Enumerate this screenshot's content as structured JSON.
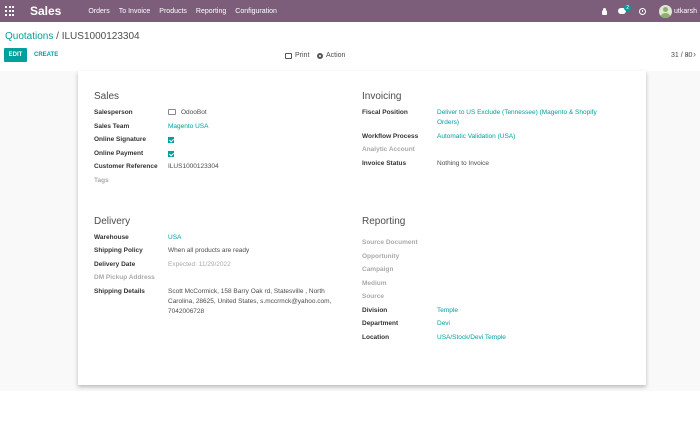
{
  "app": {
    "brand": "Sales",
    "menu": [
      "Orders",
      "To Invoice",
      "Products",
      "Reporting",
      "Configuration"
    ],
    "chat_count": "2",
    "user": "utkarsh"
  },
  "breadcrumb": {
    "parent": "Quotations",
    "separator": "/",
    "current": "ILUS1000123304"
  },
  "toolbar": {
    "edit_label": "EDIT",
    "create_label": "CREATE",
    "print_label": "Print",
    "action_label": "Action",
    "pager": "31 / 80",
    "prev": "‹",
    "next": "›"
  },
  "sales": {
    "title": "Sales",
    "salesperson_label": "Salesperson",
    "salesperson": "OdooBot",
    "sales_team_label": "Sales Team",
    "sales_team": "Magento USA",
    "online_signature_label": "Online Signature",
    "online_signature": true,
    "online_payment_label": "Online Payment",
    "online_payment": true,
    "customer_ref_label": "Customer Reference",
    "customer_ref": "ILUS1000123304",
    "tags_label": "Tags"
  },
  "invoicing": {
    "title": "Invoicing",
    "fiscal_position_label": "Fiscal Position",
    "fiscal_position_line1": "Deliver to US Exclude (Tennessee) (Magento & Shopify",
    "fiscal_position_line2": "Orders)",
    "workflow_process_label": "Workflow Process",
    "workflow_process": "Automatic Validation (USA)",
    "analytic_account_label": "Analytic Account",
    "invoice_status_label": "Invoice Status",
    "invoice_status": "Nothing to Invoice"
  },
  "delivery": {
    "title": "Delivery",
    "warehouse_label": "Warehouse",
    "warehouse": "USA",
    "shipping_policy_label": "Shipping Policy",
    "shipping_policy": "When all products are ready",
    "delivery_date_label": "Delivery Date",
    "delivery_date": "Expected: 11/29/2022",
    "dm_pickup_label": "DM Pickup Address",
    "shipping_details_label": "Shipping Details",
    "shipping_details_line1": "Scott McCormick, 158 Barry Oak rd, Statesville , North",
    "shipping_details_line2": "Carolina, 28625, United States, s.mccrmck@yahoo.com,",
    "shipping_details_line3": "7042006728"
  },
  "reporting": {
    "title": "Reporting",
    "source_document_label": "Source Document",
    "opportunity_label": "Opportunity",
    "campaign_label": "Campaign",
    "medium_label": "Medium",
    "source_label": "Source",
    "division_label": "Division",
    "division": "Temple",
    "department_label": "Department",
    "department": "Devi",
    "location_label": "Location",
    "location": "USA/Stock/Devi Temple"
  },
  "colors": {
    "navbar": "#7c5e7b",
    "accent": "#00a09d"
  }
}
